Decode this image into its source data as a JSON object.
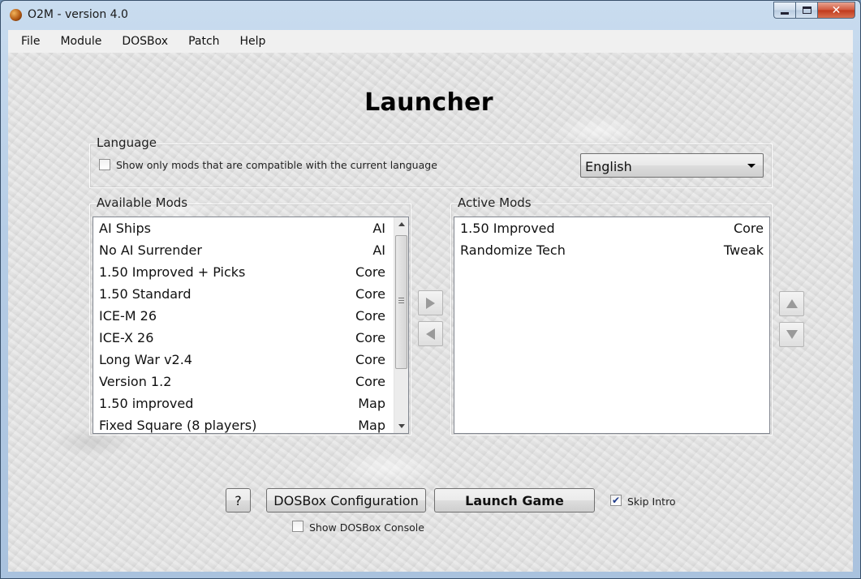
{
  "window": {
    "title": "O2M - version 4.0",
    "controls": {
      "minimize": "",
      "maximize": "",
      "close": "✕"
    }
  },
  "menu": [
    "File",
    "Module",
    "DOSBox",
    "Patch",
    "Help"
  ],
  "heading": "Launcher",
  "language": {
    "group_label": "Language",
    "filter_checkbox_label": "Show only mods that are compatible with the current language",
    "filter_checked": false,
    "selected_language": "English"
  },
  "available_mods": {
    "label": "Available Mods",
    "items": [
      {
        "name": "AI Ships",
        "category": "AI"
      },
      {
        "name": "No AI Surrender",
        "category": "AI"
      },
      {
        "name": "1.50 Improved + Picks",
        "category": "Core"
      },
      {
        "name": "1.50 Standard",
        "category": "Core"
      },
      {
        "name": "ICE-M 26",
        "category": "Core"
      },
      {
        "name": "ICE-X 26",
        "category": "Core"
      },
      {
        "name": "Long War v2.4",
        "category": "Core"
      },
      {
        "name": "Version 1.2",
        "category": "Core"
      },
      {
        "name": "1.50 improved",
        "category": "Map"
      },
      {
        "name": "Fixed Square (8 players)",
        "category": "Map"
      }
    ]
  },
  "active_mods": {
    "label": "Active Mods",
    "items": [
      {
        "name": "1.50 Improved",
        "category": "Core"
      },
      {
        "name": "Randomize Tech",
        "category": "Tweak"
      }
    ]
  },
  "actions": {
    "help_button": "?",
    "dosbox_config_button": "DOSBox Configuration",
    "launch_button": "Launch Game",
    "skip_intro_label": "Skip Intro",
    "skip_intro_checked": true,
    "show_console_label": "Show DOSBox Console",
    "show_console_checked": false
  },
  "icons": {
    "app": "o2m-app-icon",
    "move_right": "arrow-right-icon",
    "move_left": "arrow-left-icon",
    "move_up": "arrow-up-icon",
    "move_down": "arrow-down-icon"
  }
}
